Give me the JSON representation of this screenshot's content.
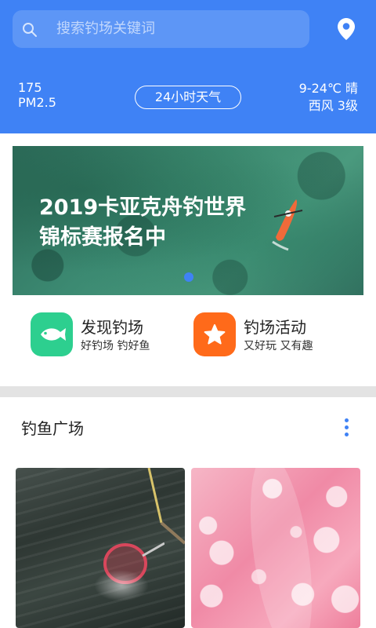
{
  "colors": {
    "brand": "#3f82f5",
    "header_bg": "#3f82f5",
    "fish_icon_bg": "#2dcf8f",
    "activity_icon_bg": "#ff6a1a",
    "section_divider": "#e3e3e3"
  },
  "search": {
    "placeholder": "搜索钓场关键词",
    "icon": "search-icon"
  },
  "location": {
    "icon": "location-pin-icon"
  },
  "weather": {
    "aqi_value": "175",
    "aqi_label": "PM2.5",
    "button_label": "24小时天气",
    "temperature": "9-24℃ 晴",
    "wind": "西风 3级"
  },
  "banner": {
    "title_line1": "2019卡亚克舟钓世界",
    "title_line2": "锦标赛报名中",
    "slide_count": 1,
    "active_slide": 1
  },
  "quick_entries": [
    {
      "title": "发现钓场",
      "subtitle": "好钓场 钓好鱼",
      "icon": "fish-icon"
    },
    {
      "title": "钓场活动",
      "subtitle": "又好玩 又有趣",
      "icon": "star-icon"
    }
  ],
  "feed": {
    "title": "钓鱼广场",
    "more_icon": "more-vertical-icon",
    "cards": [
      {
        "image": "fishing-net-photo"
      },
      {
        "image": "pink-petal-waterdrops-photo"
      }
    ]
  }
}
